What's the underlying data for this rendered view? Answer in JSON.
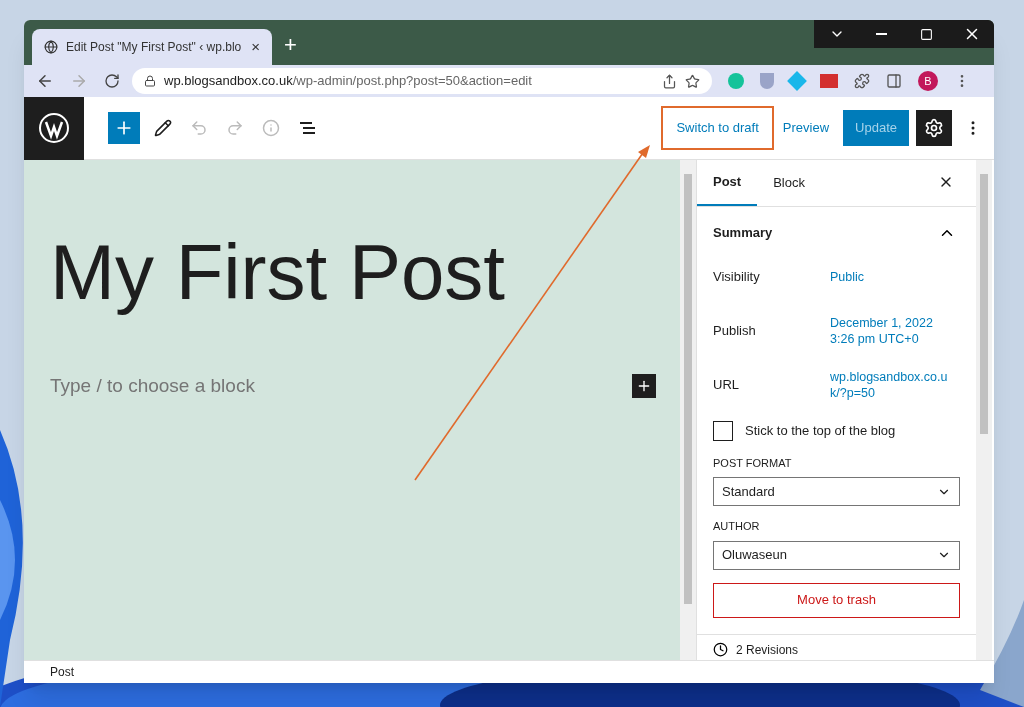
{
  "browser": {
    "tab_title": "Edit Post \"My First Post\" ‹ wp.blo",
    "tab_close": "×",
    "new_tab": "+",
    "url_host": "wp.blogsandbox.co.uk",
    "url_path": "/wp-admin/post.php?post=50&action=edit",
    "profile_initial": "B"
  },
  "toolbar": {
    "switch_to_draft": "Switch to draft",
    "preview": "Preview",
    "update": "Update",
    "highlighted": true
  },
  "editor": {
    "title": "My First Post",
    "placeholder": "Type / to choose a block"
  },
  "sidebar": {
    "tabs": [
      {
        "label": "Post",
        "selected": true
      },
      {
        "label": "Block",
        "selected": false
      }
    ],
    "summary": {
      "title": "Summary",
      "expanded": true,
      "rows": [
        {
          "label": "Visibility",
          "value": "Public"
        },
        {
          "label": "Publish",
          "value": "December 1, 2022\n3:26 pm UTC+0"
        },
        {
          "label": "URL",
          "value": "wp.blogsandbox.co.u\nk/?p=50"
        }
      ],
      "sticky": {
        "label": "Stick to the top of the blog",
        "checked": false
      },
      "post_format": {
        "label": "POST FORMAT",
        "value": "Standard"
      },
      "author": {
        "label": "AUTHOR",
        "value": "Oluwaseun"
      },
      "trash": "Move to trash"
    },
    "revisions": "2 Revisions"
  },
  "status_bar": "Post"
}
